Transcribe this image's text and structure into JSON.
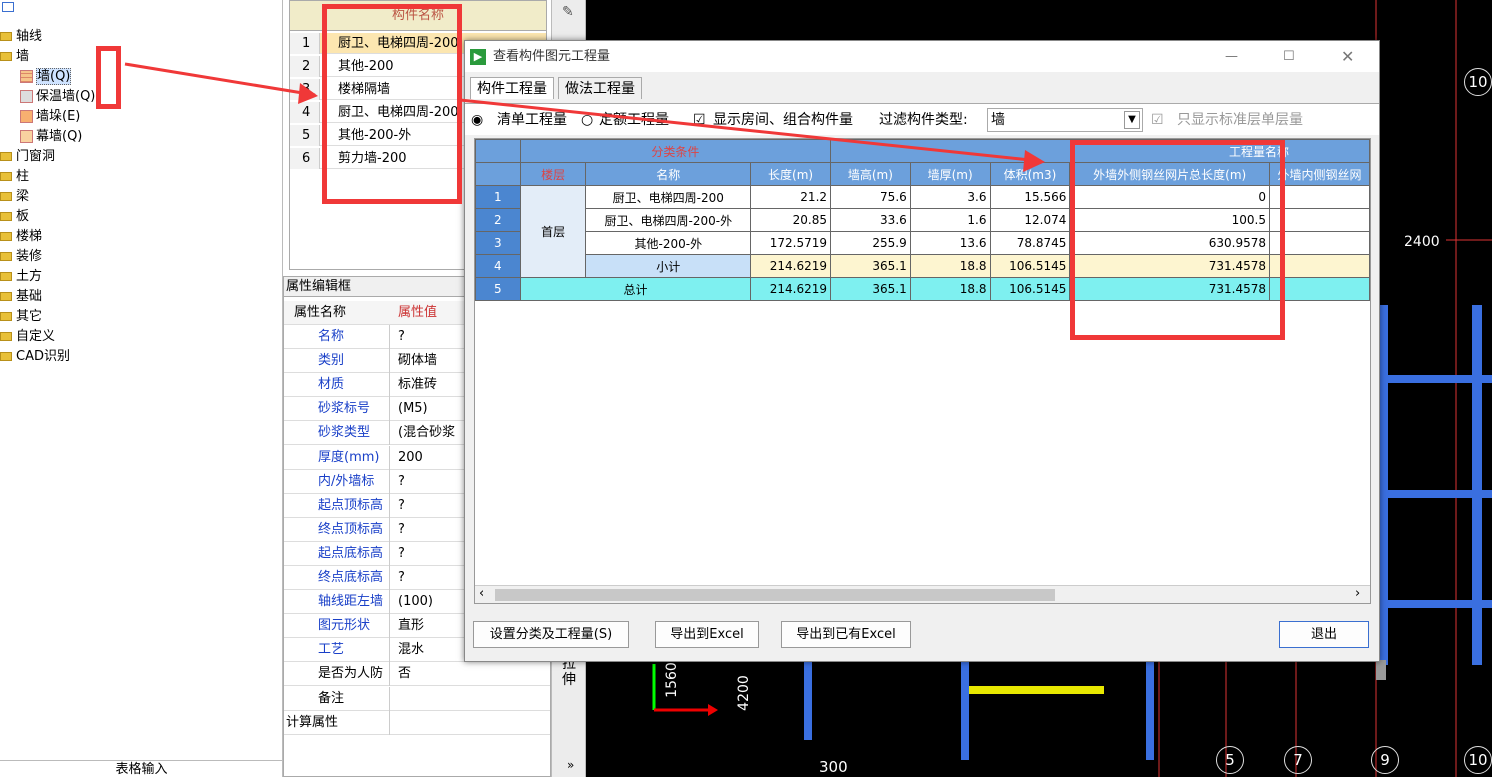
{
  "tree": {
    "items": [
      {
        "label": "轴线",
        "icon": "folder-icon"
      },
      {
        "label": "墙",
        "icon": "folder-icon"
      },
      {
        "label": "墙(Q)",
        "icon": "wall-icon"
      },
      {
        "label": "保温墙(Q)",
        "icon": "insulation-wall-icon"
      },
      {
        "label": "墙垛(E)",
        "icon": "wall-pillar-icon"
      },
      {
        "label": "幕墙(Q)",
        "icon": "curtain-wall-icon"
      },
      {
        "label": "门窗洞",
        "icon": "folder-icon"
      },
      {
        "label": "柱",
        "icon": "folder-icon"
      },
      {
        "label": "梁",
        "icon": "folder-icon"
      },
      {
        "label": "板",
        "icon": "folder-icon"
      },
      {
        "label": "楼梯",
        "icon": "folder-icon"
      },
      {
        "label": "装修",
        "icon": "folder-icon"
      },
      {
        "label": "土方",
        "icon": "folder-icon"
      },
      {
        "label": "基础",
        "icon": "folder-icon"
      },
      {
        "label": "其它",
        "icon": "folder-icon"
      },
      {
        "label": "自定义",
        "icon": "folder-icon"
      },
      {
        "label": "CAD识别",
        "icon": "folder-icon"
      }
    ],
    "footer": "表格输入"
  },
  "component_list": {
    "header": "构件名称",
    "rows": [
      {
        "num": "1",
        "name": "厨卫、电梯四周-200"
      },
      {
        "num": "2",
        "name": "其他-200"
      },
      {
        "num": "3",
        "name": "楼梯隔墙"
      },
      {
        "num": "4",
        "name": "厨卫、电梯四周-200"
      },
      {
        "num": "5",
        "name": "其他-200-外"
      },
      {
        "num": "6",
        "name": "剪力墙-200"
      }
    ]
  },
  "property": {
    "title": "属性编辑框",
    "col_name": "属性名称",
    "col_value": "属性值",
    "rows": [
      {
        "name": "名称",
        "value": "?"
      },
      {
        "name": "类别",
        "value": "砌体墙"
      },
      {
        "name": "材质",
        "value": "标准砖"
      },
      {
        "name": "砂浆标号",
        "value": "(M5)"
      },
      {
        "name": "砂浆类型",
        "value": "(混合砂浆"
      },
      {
        "name": "厚度(mm)",
        "value": "200"
      },
      {
        "name": "内/外墙标",
        "value": "?"
      },
      {
        "name": "起点顶标高",
        "value": "?"
      },
      {
        "name": "终点顶标高",
        "value": "?"
      },
      {
        "name": "起点底标高",
        "value": "?"
      },
      {
        "name": "终点底标高",
        "value": "?"
      },
      {
        "name": "轴线距左墙",
        "value": "(100)"
      },
      {
        "name": "图元形状",
        "value": "直形"
      },
      {
        "name": "工艺",
        "value": "混水"
      },
      {
        "name": "是否为人防",
        "value": "否"
      },
      {
        "name": "备注",
        "value": ""
      },
      {
        "name": "计算属性",
        "value": ""
      }
    ]
  },
  "vbar": {
    "label": "拉伸"
  },
  "cad": {
    "axis_labels": [
      "10",
      "10",
      "5",
      "7",
      "9"
    ],
    "dims": [
      "2400",
      "4200",
      "1560",
      "300"
    ]
  },
  "dialog": {
    "title": "查看构件图元工程量",
    "tabs": [
      "构件工程量",
      "做法工程量"
    ],
    "options": {
      "radio1": "清单工程量",
      "radio2": "定额工程量",
      "check1": "显示房间、组合构件量",
      "filter_label": "过滤构件类型:",
      "filter_value": "墙",
      "check2": "只显示标准层单层量"
    },
    "table": {
      "group_class": "分类条件",
      "group_qty": "工程量名称",
      "headers": [
        "楼层",
        "名称",
        "长度(m)",
        "墙高(m)",
        "墙厚(m)",
        "体积(m3)",
        "外墙外侧钢丝网片总长度(m)",
        "外墙内侧钢丝网"
      ],
      "floor": "首层",
      "rows": [
        {
          "num": "1",
          "name": "厨卫、电梯四周-200",
          "len": "21.2",
          "h": "75.6",
          "t": "3.6",
          "v": "15.566",
          "mesh": "0"
        },
        {
          "num": "2",
          "name": "厨卫、电梯四周-200-外",
          "len": "20.85",
          "h": "33.6",
          "t": "1.6",
          "v": "12.074",
          "mesh": "100.5"
        },
        {
          "num": "3",
          "name": "其他-200-外",
          "len": "172.5719",
          "h": "255.9",
          "t": "13.6",
          "v": "78.8745",
          "mesh": "630.9578"
        },
        {
          "num": "4",
          "name": "小计",
          "len": "214.6219",
          "h": "365.1",
          "t": "18.8",
          "v": "106.5145",
          "mesh": "731.4578"
        },
        {
          "num": "5",
          "name": "总计",
          "len": "214.6219",
          "h": "365.1",
          "t": "18.8",
          "v": "106.5145",
          "mesh": "731.4578"
        }
      ]
    },
    "buttons": {
      "set": "设置分类及工程量(S)",
      "export": "导出到Excel",
      "export_existing": "导出到已有Excel",
      "exit": "退出"
    }
  }
}
